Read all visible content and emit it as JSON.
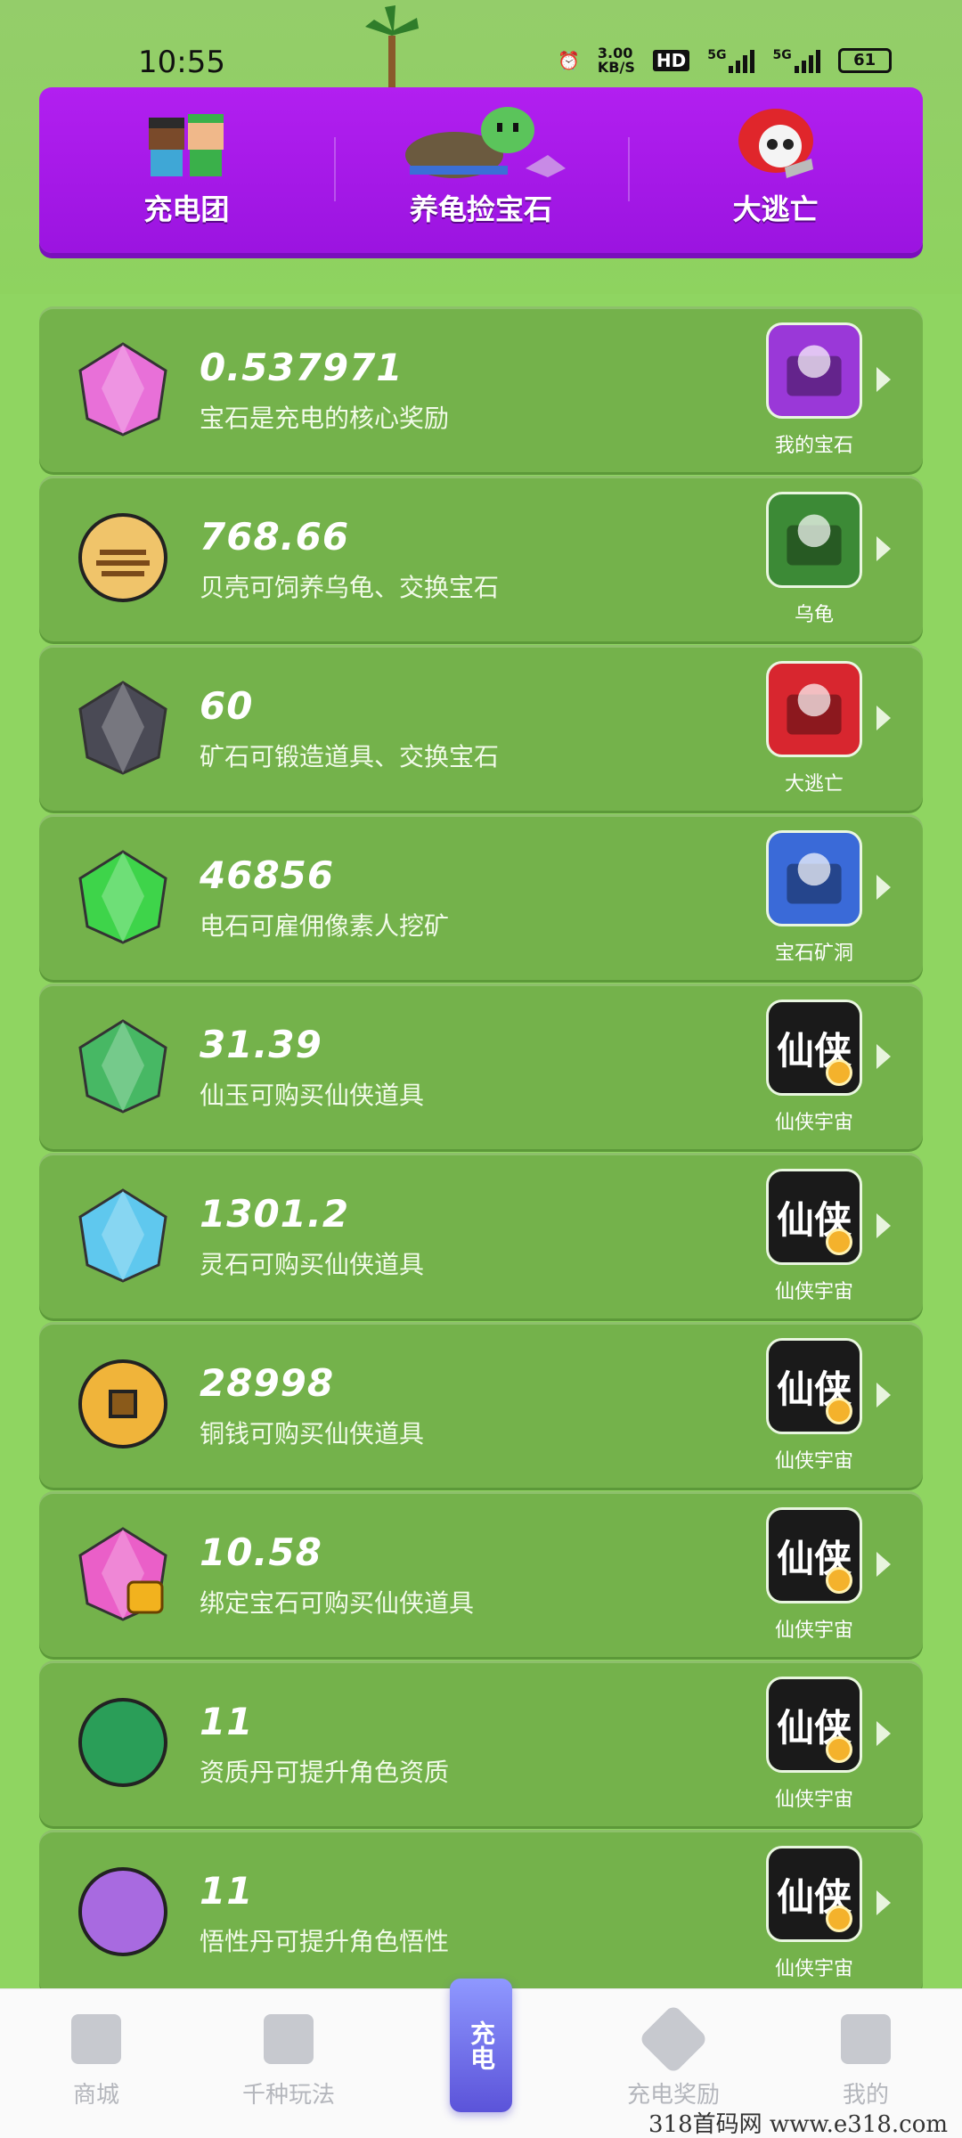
{
  "status": {
    "time": "10:55",
    "net_speed": "3.00",
    "net_unit": "KB/S",
    "hd": "HD",
    "sig1": "5G",
    "sig2": "5G",
    "battery": "61"
  },
  "banner": [
    {
      "label": "充电团",
      "icon": "characters-icon"
    },
    {
      "label": "养龟捡宝石",
      "icon": "turtle-icon"
    },
    {
      "label": "大逃亡",
      "icon": "skull-icon"
    }
  ],
  "items": [
    {
      "value": "0.537971",
      "desc": "宝石是充电的核心奖励",
      "icon": "pink-gem-icon",
      "app_label": "我的宝石",
      "app_icon": "gem-chest-icon",
      "color": "#e870d8"
    },
    {
      "value": "768.66",
      "desc": "贝壳可饲养乌龟、交换宝石",
      "icon": "shell-icon",
      "app_label": "乌龟",
      "app_icon": "turtle-icon",
      "color": "#f0c46a"
    },
    {
      "value": "60",
      "desc": "矿石可锻造道具、交换宝石",
      "icon": "ore-icon",
      "app_label": "大逃亡",
      "app_icon": "skull-icon",
      "color": "#4a4a55"
    },
    {
      "value": "46856",
      "desc": "电石可雇佣像素人挖矿",
      "icon": "electric-stone-icon",
      "app_label": "宝石矿洞",
      "app_icon": "mine-icon",
      "color": "#3ed44a"
    },
    {
      "value": "31.39",
      "desc": "仙玉可购买仙侠道具",
      "icon": "jade-icon",
      "app_label": "仙侠宇宙",
      "app_icon": "xianxia-icon",
      "color": "#47b864"
    },
    {
      "value": "1301.2",
      "desc": "灵石可购买仙侠道具",
      "icon": "spirit-stone-icon",
      "app_label": "仙侠宇宙",
      "app_icon": "xianxia-icon",
      "color": "#5fc8ee"
    },
    {
      "value": "28998",
      "desc": "铜钱可购买仙侠道具",
      "icon": "copper-coin-icon",
      "app_label": "仙侠宇宙",
      "app_icon": "xianxia-icon",
      "color": "#f0b43a"
    },
    {
      "value": "10.58",
      "desc": "绑定宝石可购买仙侠道具",
      "icon": "locked-gem-icon",
      "app_label": "仙侠宇宙",
      "app_icon": "xianxia-icon",
      "color": "#ea5fc8"
    },
    {
      "value": "11",
      "desc": "资质丹可提升角色资质",
      "icon": "green-pill-icon",
      "app_label": "仙侠宇宙",
      "app_icon": "xianxia-icon",
      "color": "#2a9e58"
    },
    {
      "value": "11",
      "desc": "悟性丹可提升角色悟性",
      "icon": "purple-pill-icon",
      "app_label": "仙侠宇宙",
      "app_icon": "xianxia-icon",
      "color": "#a86ae0"
    }
  ],
  "xianxia_text": "仙侠",
  "tabs": [
    {
      "label": "商城",
      "icon": "shop-icon"
    },
    {
      "label": "千种玩法",
      "icon": "games-icon"
    },
    {
      "label": "充电",
      "icon": "charge-plug-icon"
    },
    {
      "label": "充电奖励",
      "icon": "reward-icon"
    },
    {
      "label": "我的",
      "icon": "profile-icon"
    }
  ],
  "watermark": "318首码网  www.e318.com"
}
